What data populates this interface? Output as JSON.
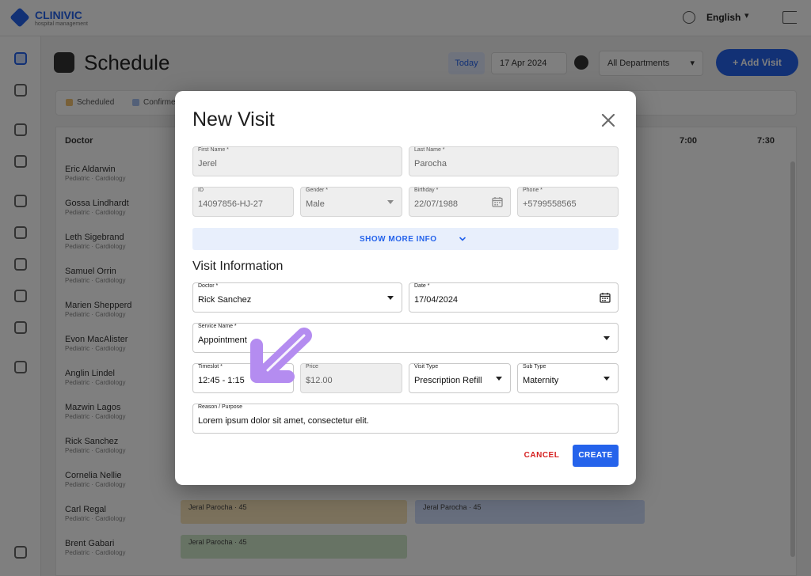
{
  "background": {
    "app_name": "CLINIVIC",
    "app_tagline": "hospital management",
    "language": "English",
    "page_title": "Schedule",
    "view_today": "Today",
    "view_date": "17 Apr 2024",
    "department_select": "All Departments",
    "add_visit_label": "+ Add Visit",
    "filter_chips": [
      "Scheduled",
      "Confirmed"
    ],
    "grid_header": "Doctor",
    "time_headers": [
      "7:00",
      "7:30"
    ],
    "doctors": [
      {
        "name": "Eric Aldarwin",
        "sub": "Pediatric · Cardiology"
      },
      {
        "name": "Gossa Lindhardt",
        "sub": "Pediatric · Cardiology"
      },
      {
        "name": "Leth Sigebrand",
        "sub": "Pediatric · Cardiology"
      },
      {
        "name": "Samuel Orrin",
        "sub": "Pediatric · Cardiology"
      },
      {
        "name": "Marien Shepperd",
        "sub": "Pediatric · Cardiology"
      },
      {
        "name": "Evon MacAlister",
        "sub": "Pediatric · Cardiology"
      },
      {
        "name": "Anglin Lindel",
        "sub": "Pediatric · Cardiology"
      },
      {
        "name": "Mazwin Lagos",
        "sub": "Pediatric · Cardiology"
      },
      {
        "name": "Rick Sanchez",
        "sub": "Pediatric · Cardiology"
      },
      {
        "name": "Cornelia Nellie",
        "sub": "Pediatric · Cardiology"
      },
      {
        "name": "Carl Regal",
        "sub": "Pediatric · Cardiology"
      },
      {
        "name": "Brent Gabari",
        "sub": "Pediatric · Cardiology"
      }
    ],
    "slots": [
      "Jeral Parocha · 45",
      "Jeral Parocha · 45",
      "Jeral Parocha · 45"
    ]
  },
  "modal": {
    "title": "New Visit",
    "first_name": {
      "label": "First Name *",
      "value": "Jerel"
    },
    "last_name": {
      "label": "Last Name *",
      "value": "Parocha"
    },
    "id": {
      "label": "ID",
      "value": "14097856-HJ-27"
    },
    "gender": {
      "label": "Gender *",
      "value": "Male"
    },
    "birthday": {
      "label": "Birthday *",
      "value": "22/07/1988"
    },
    "phone": {
      "label": "Phone *",
      "value": "+5799558565"
    },
    "show_more": "SHOW MORE INFO",
    "section_title": "Visit Information",
    "doctor": {
      "label": "Doctor *",
      "value": "Rick Sanchez"
    },
    "date": {
      "label": "Date *",
      "value": "17/04/2024"
    },
    "service": {
      "label": "Service Name *",
      "value": "Appointment"
    },
    "timeslot": {
      "label": "Timeslot *",
      "value": "12:45 - 1:15"
    },
    "price": {
      "label": "Price",
      "value": "$12.00"
    },
    "visit_type": {
      "label": "Visit Type",
      "value": "Prescription Refill"
    },
    "sub_type": {
      "label": "Sub Type",
      "value": "Maternity"
    },
    "reason": {
      "label": "Reason / Purpose",
      "value": "Lorem ipsum dolor sit amet, consectetur elit."
    },
    "cancel_label": "CANCEL",
    "create_label": "CREATE"
  },
  "colors": {
    "accent": "#2563eb",
    "cancel": "#d62020",
    "annotation_arrow": "#b48cf0"
  }
}
